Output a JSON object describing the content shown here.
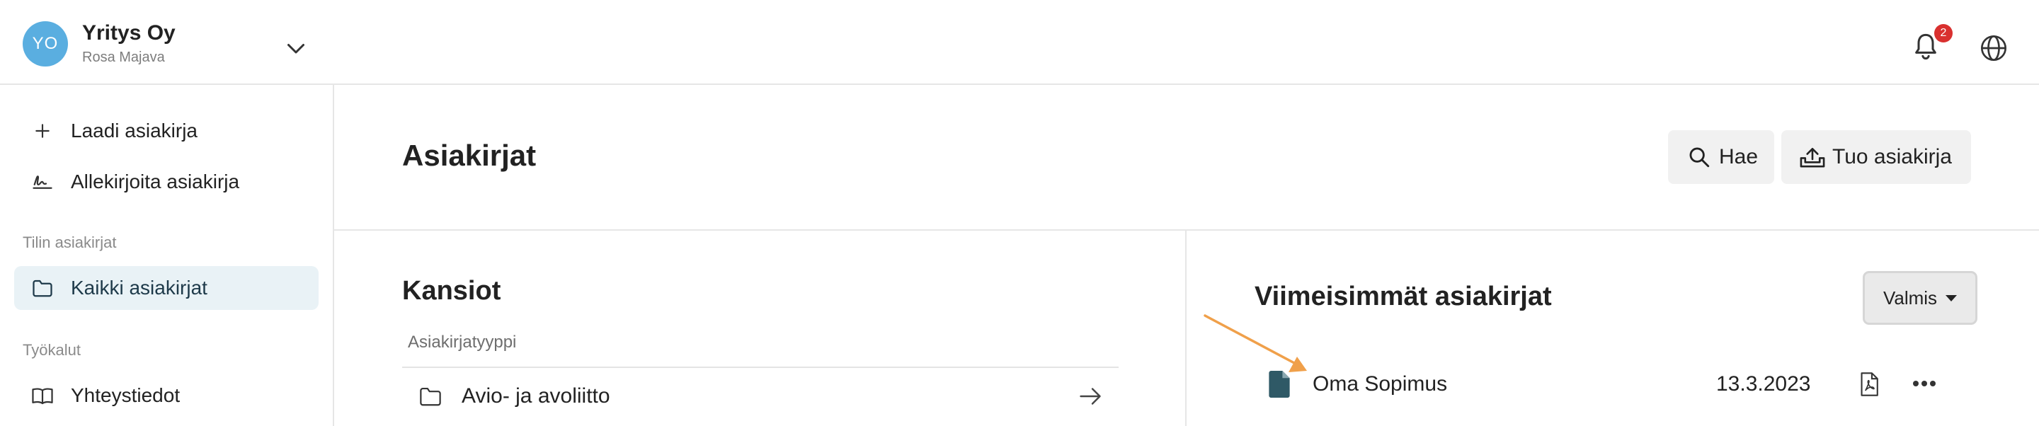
{
  "header": {
    "avatar_initials": "YO",
    "company_name": "Yritys Oy",
    "user_name": "Rosa Majava",
    "notification_count": "2",
    "icons": [
      "chevron-down-icon",
      "bell-icon",
      "globe-icon"
    ]
  },
  "sidebar": {
    "items": [
      {
        "label": "Laadi asiakirja",
        "icon": "plus-icon"
      },
      {
        "label": "Allekirjoita asiakirja",
        "icon": "signature-icon"
      }
    ],
    "section_account": "Tilin asiakirjat",
    "account_items": [
      {
        "label": "Kaikki asiakirjat",
        "icon": "folder-icon",
        "active": true
      }
    ],
    "section_tools": "Työkalut",
    "tool_items": [
      {
        "label": "Yhteystiedot",
        "icon": "book-icon"
      }
    ]
  },
  "main": {
    "title": "Asiakirjat",
    "search_button": "Hae",
    "import_button": "Tuo asiakirja",
    "folders": {
      "title": "Kansiot",
      "column_header": "Asiakirjatyyppi",
      "rows": [
        {
          "label": "Avio- ja avoliitto"
        }
      ]
    },
    "recent": {
      "title": "Viimeisimmät asiakirjat",
      "status_select": "Valmis",
      "rows": [
        {
          "name": "Oma Sopimus",
          "date": "13.3.2023"
        }
      ]
    }
  },
  "colors": {
    "avatar": "#5aaee0",
    "badge": "#d9302f",
    "active_item_bg": "#e9f2f6",
    "doc_icon": "#2f5966",
    "annotation_arrow": "#f0a04a"
  }
}
